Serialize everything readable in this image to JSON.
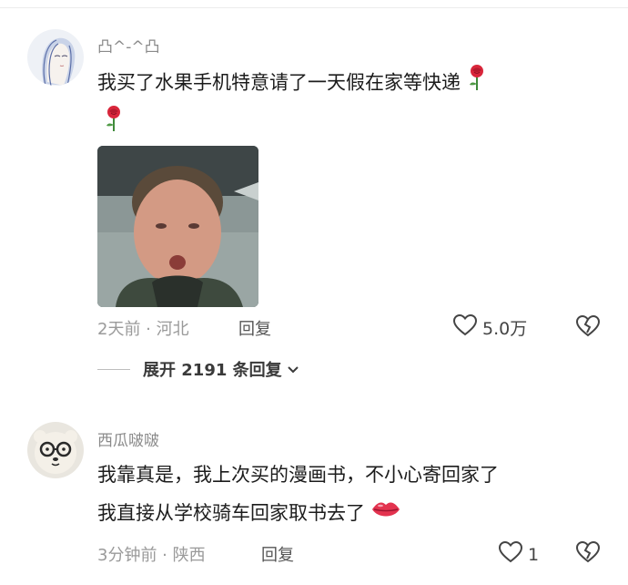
{
  "comments": [
    {
      "username": "凸^-^凸",
      "text_line1": "我买了水果手机特意请了一天假在家等快递",
      "time_location": "2天前 · 河北",
      "reply_label": "回复",
      "likes": "5.0万",
      "emojis": [
        "rose-emoji",
        "rose-emoji"
      ],
      "has_image": true
    },
    {
      "username": "西瓜啵啵",
      "text_line1": "我靠真是，我上次买的漫画书，不小心寄回家了",
      "text_line2": "我直接从学校骑车回家取书去了",
      "time_location": "3分钟前 · 陕西",
      "reply_label": "回复",
      "likes": "1",
      "emojis": [
        "kiss-lips-emoji"
      ]
    }
  ],
  "expand_replies": {
    "label": "展开 2191 条回复"
  },
  "icons": {
    "like": "heart-outline-icon",
    "dislike": "broken-heart-outline-icon",
    "expand": "chevron-down-icon"
  },
  "colors": {
    "meta_gray": "#9a9a9a",
    "rose_red": "#d9263b"
  }
}
